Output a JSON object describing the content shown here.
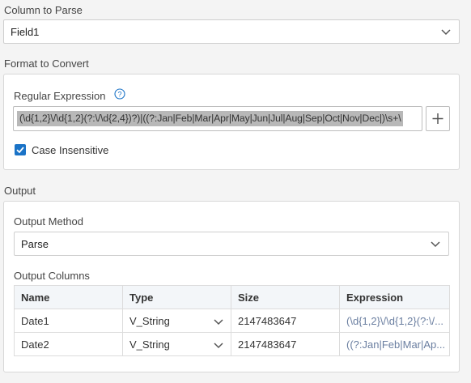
{
  "column_to_parse": {
    "title": "Column to Parse",
    "value": "Field1"
  },
  "format_to_convert": {
    "title": "Format to Convert",
    "regex_label": "Regular Expression",
    "regex_value": "(\\d{1,2}\\/\\d{1,2}(?:\\/\\d{2,4})?)|((?:Jan|Feb|Mar|Apr|May|Jun|Jul|Aug|Sep|Oct|Nov|Dec|)\\s+\\",
    "case_insensitive_label": "Case Insensitive",
    "case_insensitive_checked": true
  },
  "output": {
    "title": "Output",
    "method_label": "Output Method",
    "method_value": "Parse",
    "columns_label": "Output Columns",
    "headers": [
      "Name",
      "Type",
      "Size",
      "Expression"
    ],
    "rows": [
      {
        "name": "Date1",
        "type": "V_String",
        "size": "2147483647",
        "expression": "(\\d{1,2}\\/\\d{1,2}(?:\\/..."
      },
      {
        "name": "Date2",
        "type": "V_String",
        "size": "2147483647",
        "expression": "((?:Jan|Feb|Mar|Ap..."
      }
    ]
  },
  "colors": {
    "accent": "#1a73c7",
    "expression_text": "#6a7ea0"
  }
}
